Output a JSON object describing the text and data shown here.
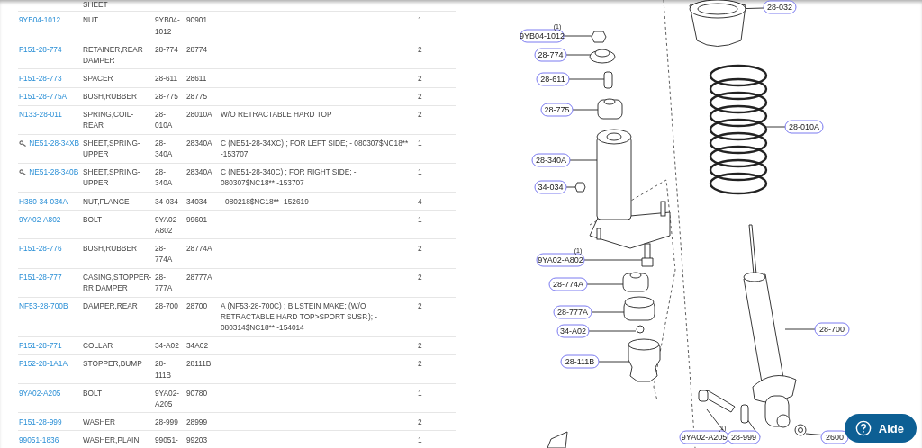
{
  "parts_table": {
    "rows": [
      {
        "name": "SHEET",
        "linked": false
      },
      {
        "part_no": "9YB04-1012",
        "name": "NUT",
        "ref": "9YB04-1012",
        "code": "90901",
        "qty": "1",
        "linked": false
      },
      {
        "part_no": "F151-28-774",
        "name": "RETAINER,REAR DAMPER",
        "ref": "28-774",
        "code": "28774",
        "qty": "2",
        "linked": false
      },
      {
        "part_no": "F151-28-773",
        "name": "SPACER",
        "ref": "28-611",
        "code": "28611",
        "qty": "2",
        "linked": false
      },
      {
        "part_no": "F151-28-775A",
        "name": "BUSH,RUBBER",
        "ref": "28-775",
        "code": "28775",
        "qty": "2",
        "linked": false
      },
      {
        "part_no": "N133-28-011",
        "name": "SPRING,COIL-REAR",
        "ref": "28-010A",
        "code": "28010A",
        "note": "W/O RETRACTABLE HARD TOP",
        "qty": "2",
        "linked": false
      },
      {
        "part_no": "NE51-28-34XB",
        "name": "SHEET,SPRING-UPPER",
        "ref": "28-340A",
        "code": "28340A",
        "note": "C (NE51-28-34XC) ; FOR LEFT SIDE; - 080307$NC18** -153707",
        "qty": "1",
        "linked": true
      },
      {
        "part_no": "NE51-28-340B",
        "name": "SHEET,SPRING-UPPER",
        "ref": "28-340A",
        "code": "28340A",
        "note": "C (NE51-28-340C) ; FOR RIGHT SIDE; - 080307$NC18** -153707",
        "qty": "1",
        "linked": true
      },
      {
        "part_no": "H380-34-034A",
        "name": "NUT,FLANGE",
        "ref": "34-034",
        "code": "34034",
        "note": "- 080218$NC18** -152619",
        "qty": "4",
        "linked": false
      },
      {
        "part_no": "9YA02-A802",
        "name": "BOLT",
        "ref": "9YA02-A802",
        "code": "99601",
        "qty": "1",
        "linked": false
      },
      {
        "part_no": "F151-28-776",
        "name": "BUSH,RUBBER",
        "ref": "28-774A",
        "code": "28774A",
        "qty": "2",
        "linked": false
      },
      {
        "part_no": "F151-28-777",
        "name": "CASING,STOPPER-RR DAMPER",
        "ref": "28-777A",
        "code": "28777A",
        "qty": "2",
        "linked": false
      },
      {
        "part_no": "NF53-28-700B",
        "name": "DAMPER,REAR",
        "ref": "28-700",
        "code": "28700",
        "note": "A (NF53-28-700C) ; BILSTEIN MAKE; (W/O RETRACTABLE HARD TOP>SPORT SUSP.); - 080314$NC18** -154014",
        "qty": "2",
        "linked": false
      },
      {
        "part_no": "F151-28-771",
        "name": "COLLAR",
        "ref": "34-A02",
        "code": "34A02",
        "qty": "2",
        "linked": false
      },
      {
        "part_no": "F152-28-1A1A",
        "name": "STOPPER,BUMP",
        "ref": "28-111B",
        "code": "28111B",
        "qty": "2",
        "linked": false
      },
      {
        "part_no": "9YA02-A205",
        "name": "BOLT",
        "ref": "9YA02-A205",
        "code": "90780",
        "qty": "1",
        "linked": false
      },
      {
        "part_no": "F151-28-999",
        "name": "WASHER",
        "ref": "28-999",
        "code": "28999",
        "qty": "2",
        "linked": false
      },
      {
        "part_no": "99051-1836",
        "name": "WASHER,PLAIN",
        "ref": "99051-",
        "code": "99203",
        "qty": "1",
        "linked": false
      }
    ]
  },
  "diagram": {
    "callouts": [
      {
        "label": "28-032"
      },
      {
        "label": "9YB04-1012",
        "marker": "(1)"
      },
      {
        "label": "28-774"
      },
      {
        "label": "28-611"
      },
      {
        "label": "28-775"
      },
      {
        "label": "28-010A"
      },
      {
        "label": "28-340A"
      },
      {
        "label": "34-034"
      },
      {
        "label": "9YA02-A802",
        "marker": "(1)"
      },
      {
        "label": "28-774A"
      },
      {
        "label": "28-777A"
      },
      {
        "label": "28-700"
      },
      {
        "label": "34-A02"
      },
      {
        "label": "28-111B"
      },
      {
        "label": "9YA02-A205",
        "marker": "(1)"
      },
      {
        "label": "28-999"
      },
      {
        "label": "2600"
      }
    ]
  },
  "help_button": {
    "label": "Aide"
  }
}
